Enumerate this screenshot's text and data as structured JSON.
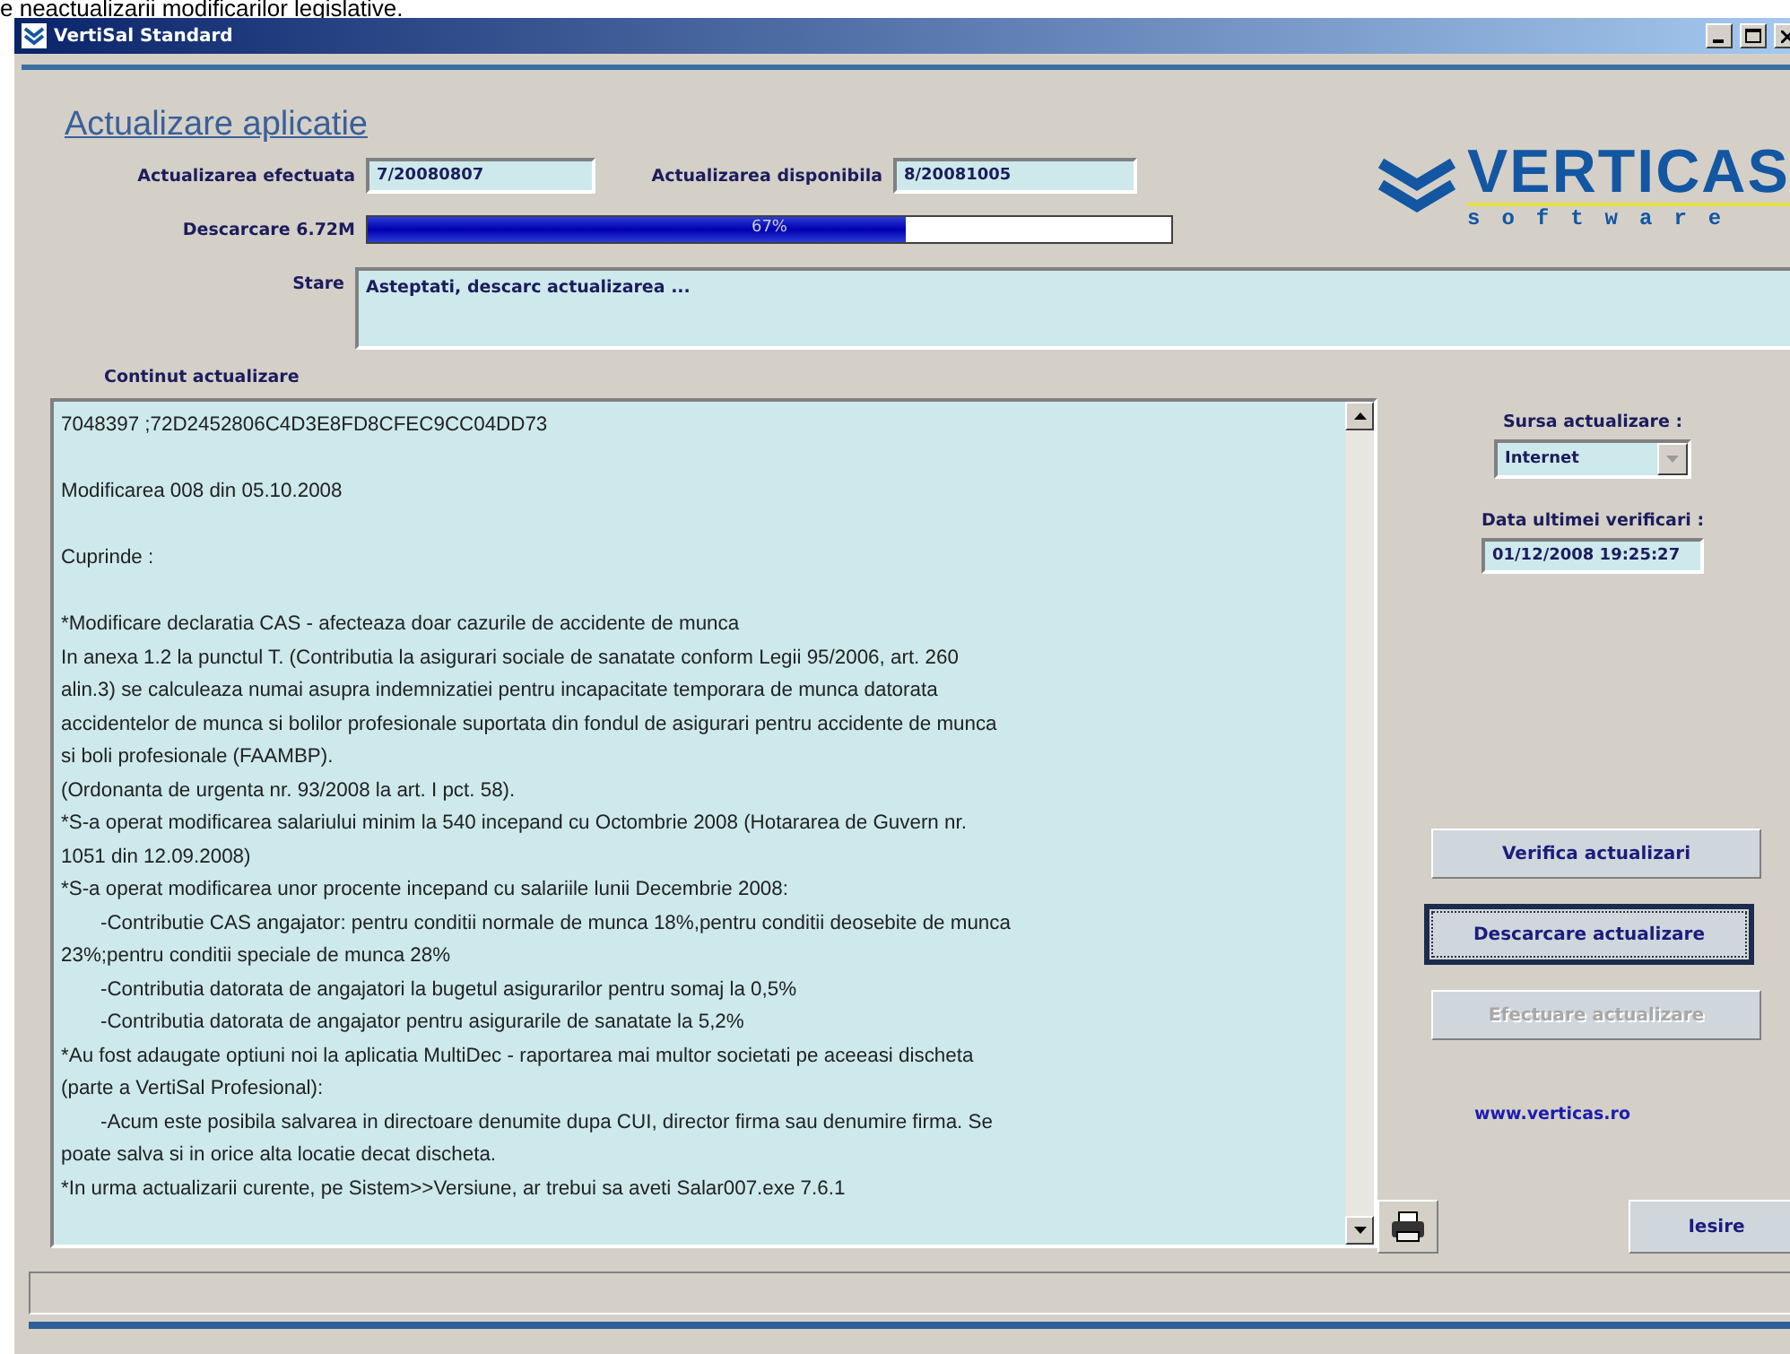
{
  "caption": "e neactualizarii modificarilor legislative.",
  "window": {
    "title": "VertiSal Standard"
  },
  "heading": "Actualizare aplicatie",
  "logo": {
    "name": "VERTICAS",
    "tagline": "software"
  },
  "fields": [
    {
      "label": "Actualizarea efectuata",
      "value": "7/20080807"
    },
    {
      "label": "Actualizarea disponibila",
      "value": "8/20081005"
    }
  ],
  "download": {
    "label": "Descarcare 6.72M",
    "level": 0.67,
    "reading": "67%"
  },
  "status": {
    "label": "Stare",
    "value": "Asteptati, descarc actualizarea ..."
  },
  "content": {
    "label": "Continut actualizare",
    "lines": [
      {
        "text": "7048397 ;72D2452806C4D3E8FD8CFEC9CC04DD73",
        "indent": false,
        "gap_before": false
      },
      {
        "text": "Modificarea 008 din 05.10.2008",
        "indent": false,
        "gap_before": true
      },
      {
        "text": "Cuprinde :",
        "indent": false,
        "gap_before": true
      },
      {
        "text": "*Modificare declaratia CAS - afecteaza doar cazurile de accidente de munca",
        "indent": false,
        "gap_before": true
      },
      {
        "text": "In anexa 1.2 la punctul T. (Contributia la asigurari sociale de sanatate conform Legii 95/2006, art. 260",
        "indent": false,
        "gap_before": false
      },
      {
        "text": "alin.3) se calculeaza numai asupra indemnizatiei pentru incapacitate temporara de munca datorata",
        "indent": false,
        "gap_before": false
      },
      {
        "text": "accidentelor de munca si bolilor profesionale suportata din fondul de asigurari pentru accidente de munca",
        "indent": false,
        "gap_before": false
      },
      {
        "text": "si boli profesionale (FAAMBP).",
        "indent": false,
        "gap_before": false
      },
      {
        "text": "(Ordonanta de urgenta nr. 93/2008 la art. I pct. 58).",
        "indent": false,
        "gap_before": false
      },
      {
        "text": "*S-a operat modificarea salariului minim la 540 incepand cu Octombrie 2008 (Hotararea de Guvern nr.",
        "indent": false,
        "gap_before": false
      },
      {
        "text": "1051 din 12.09.2008)",
        "indent": false,
        "gap_before": false
      },
      {
        "text": "*S-a operat modificarea unor procente incepand cu salariile lunii Decembrie 2008:",
        "indent": false,
        "gap_before": false
      },
      {
        "text": "-Contributie CAS angajator: pentru conditii normale de munca 18%,pentru conditii deosebite de munca",
        "indent": true,
        "gap_before": false
      },
      {
        "text": "23%;pentru conditii speciale de munca 28%",
        "indent": false,
        "gap_before": false
      },
      {
        "text": "-Contributia datorata de angajatori la bugetul asigurarilor pentru somaj la 0,5%",
        "indent": true,
        "gap_before": false
      },
      {
        "text": "-Contributia datorata de angajator pentru asigurarile de sanatate la 5,2%",
        "indent": true,
        "gap_before": false
      },
      {
        "text": "*Au fost adaugate optiuni noi la aplicatia MultiDec - raportarea mai multor societati pe aceeasi discheta",
        "indent": false,
        "gap_before": false
      },
      {
        "text": "(parte a VertiSal Profesional):",
        "indent": false,
        "gap_before": false
      },
      {
        "text": "-Acum este posibila salvarea in directoare denumite dupa CUI, director firma sau denumire firma. Se",
        "indent": true,
        "gap_before": false
      },
      {
        "text": "poate salva si in orice alta locatie decat discheta.",
        "indent": false,
        "gap_before": false
      },
      {
        "text": "*In urma actualizarii curente, pe Sistem>>Versiune, ar trebui sa aveti Salar007.exe 7.6.1",
        "indent": false,
        "gap_before": false
      }
    ]
  },
  "source": {
    "label": "Sursa actualizare :",
    "value": "Internet"
  },
  "last_check": {
    "label": "Data ultimei verificari :",
    "value": "01/12/2008 19:25:27"
  },
  "buttons": [
    {
      "label": "Verifica actualizari",
      "focused": false,
      "disabled": false
    },
    {
      "label": "Descarcare actualizare",
      "focused": true,
      "disabled": false
    },
    {
      "label": "Efectuare actualizare",
      "focused": false,
      "disabled": true
    }
  ],
  "website": "www.verticas.ro",
  "exit_button": "Iesire"
}
